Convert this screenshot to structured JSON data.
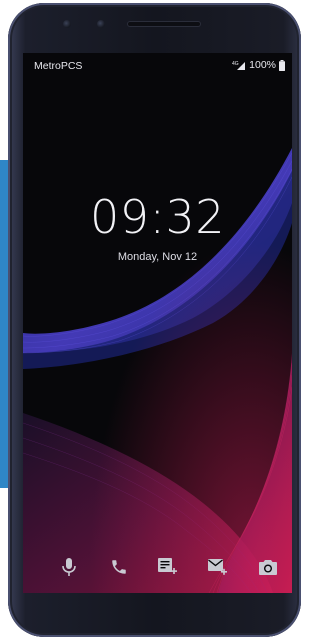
{
  "status_bar": {
    "carrier": "MetroPCS",
    "battery_percent": "100%",
    "signal_icon": "signal-icon",
    "battery_icon": "battery-icon"
  },
  "lock_screen": {
    "time": "09:32",
    "date": "Monday, Nov 12"
  },
  "shortcuts": [
    {
      "icon": "microphone-icon"
    },
    {
      "icon": "phone-icon"
    },
    {
      "icon": "new-note-icon"
    },
    {
      "icon": "new-message-icon"
    },
    {
      "icon": "camera-icon"
    }
  ],
  "colors": {
    "accent_blue": "#2f86c6",
    "wave_blue": "#3a46c8",
    "wave_magenta": "#d4205a",
    "screen_background": "#07070a"
  }
}
